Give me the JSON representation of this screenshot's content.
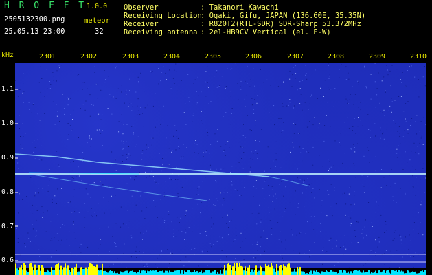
{
  "header": {
    "app_name": "H R O F F T",
    "version": "1.0.0",
    "filename": "2505132300.png",
    "datetime": "25.05.13 23:00",
    "meteor_label": "meteor",
    "meteor_count": "32",
    "info": [
      {
        "label": "Observer",
        "value": ": Takanori Kawachi"
      },
      {
        "label": "Receiving Location",
        "value": ": Ogaki, Gifu, JAPAN (136.60E, 35.35N)"
      },
      {
        "label": "Receiver",
        "value": ": R820T2(RTL-SDR) SDR-Sharp 53.372MHz"
      },
      {
        "label": "Receiving antenna",
        "value": ": 2el-HB9CV Vertical (el. E-W)"
      }
    ]
  },
  "axis": {
    "y_unit": "kHz",
    "y_ticks": [
      "1.1",
      "1.0",
      "0.9",
      "0.8",
      "0.7",
      "0.6"
    ],
    "x_ticks": [
      "2301",
      "2302",
      "2303",
      "2304",
      "2305",
      "2306",
      "2307",
      "2308",
      "2309",
      "2310"
    ]
  },
  "colors": {
    "background": "#1e2cb8",
    "signal": "#ffffff",
    "trace": "#00e5ff",
    "bars": "#ffff00"
  }
}
